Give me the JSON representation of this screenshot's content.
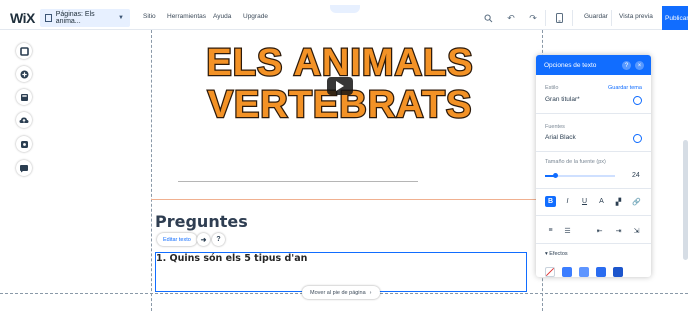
{
  "topbar": {
    "logo": "WiX",
    "pages_label": "Páginas: Els anima...",
    "menu": [
      "Sitio",
      "Herramientas",
      "Ayuda",
      "Upgrade"
    ],
    "save_label": "Guardar",
    "preview_label": "Vista previa",
    "publish_label": "Publicar",
    "accent_color": "#116dff"
  },
  "left_toolbar": {
    "icons": [
      "add-elements-icon",
      "add-section-icon",
      "pages-icon",
      "upload-icon",
      "media-icon",
      "blog-icon"
    ]
  },
  "canvas": {
    "title_line1": "ELS ANIMALS",
    "title_line2": "VERTEBRATS",
    "title_color": "#f39226",
    "heading": "Preguntes",
    "edit_text_label": "Editar texto",
    "question_text": "1. Quins són els 5 tipus d'an",
    "footer_pill_label": "Mover al pie de página"
  },
  "text_panel": {
    "title": "Opciones de texto",
    "style_label": "Estilo",
    "style_value": "Gran titular*",
    "save_theme_link": "Guardar tema",
    "font_label": "Fuentes",
    "font_value": "Arial Black",
    "size_label": "Tamaño de la fuente (px)",
    "size_value": "24",
    "size_fraction": 0.15,
    "effects_label": "Efectos"
  }
}
